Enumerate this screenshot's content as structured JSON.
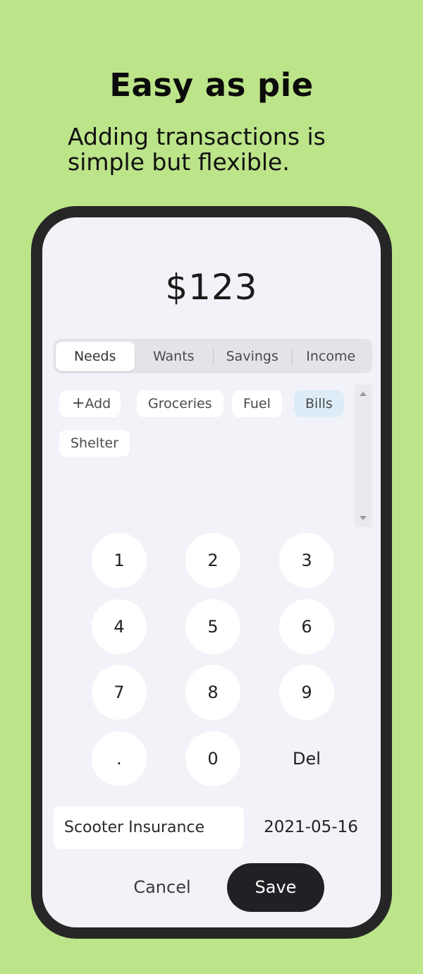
{
  "promo": {
    "headline": "Easy as pie",
    "subhead": "Adding transactions is simple but flexible."
  },
  "amount": "$123",
  "segments": [
    {
      "label": "Needs",
      "active": true
    },
    {
      "label": "Wants",
      "active": false
    },
    {
      "label": "Savings",
      "active": false
    },
    {
      "label": "Income",
      "active": false
    }
  ],
  "categories": {
    "add_label": "Add",
    "items": [
      {
        "label": "Groceries",
        "selected": false
      },
      {
        "label": "Fuel",
        "selected": false
      },
      {
        "label": "Bills",
        "selected": true
      },
      {
        "label": "Shelter",
        "selected": false
      }
    ]
  },
  "keypad": [
    "1",
    "2",
    "3",
    "4",
    "5",
    "6",
    "7",
    "8",
    "9",
    ".",
    "0",
    "Del"
  ],
  "description_value": "Scooter Insurance",
  "date": "2021-05-16",
  "actions": {
    "cancel": "Cancel",
    "save": "Save"
  },
  "colors": {
    "background": "#bce489",
    "phone_frame": "#262626",
    "screen": "#f2f3f8",
    "save_button": "#202124",
    "selected_chip": "#ddecf7"
  }
}
